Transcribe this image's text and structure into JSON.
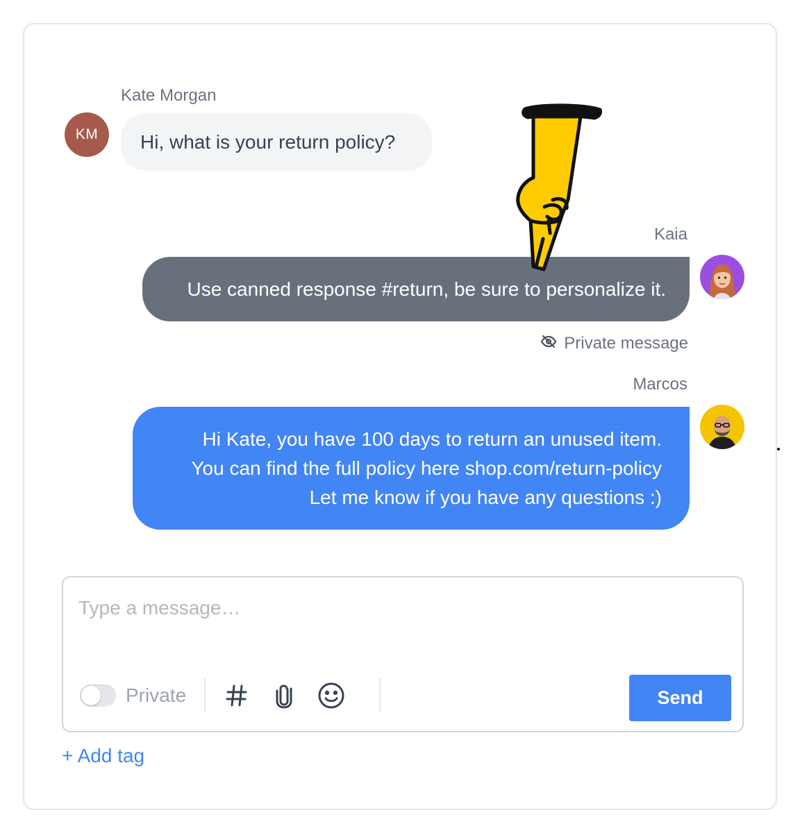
{
  "messages": [
    {
      "sender": "Kate Morgan",
      "avatar_initials": "KM",
      "text": "Hi, what is your return policy?"
    },
    {
      "sender": "Kaia",
      "avatar_icon": "woman-avatar-icon",
      "text": "Use canned response #return, be sure to personalize it.",
      "note": "Private message"
    },
    {
      "sender": "Marcos",
      "avatar_icon": "man-avatar-icon",
      "lines": [
        "Hi Kate, you have 100 days to return an unused item.",
        "You can find the full policy here shop.com/return-policy",
        "Let me know if you have any questions :)"
      ]
    }
  ],
  "composer": {
    "placeholder": "Type a message…",
    "private_label": "Private",
    "private_enabled": false,
    "send_label": "Send",
    "icons": [
      "hashtag-icon",
      "paperclip-icon",
      "emoji-icon"
    ]
  },
  "add_tag_label": "+ Add tag",
  "colors": {
    "accent": "#4285f4",
    "private_bubble": "#68717b",
    "customer_bubble": "#f3f4f6",
    "customer_avatar": "#a65a4b",
    "pointer_hand": "#ffcc00"
  }
}
